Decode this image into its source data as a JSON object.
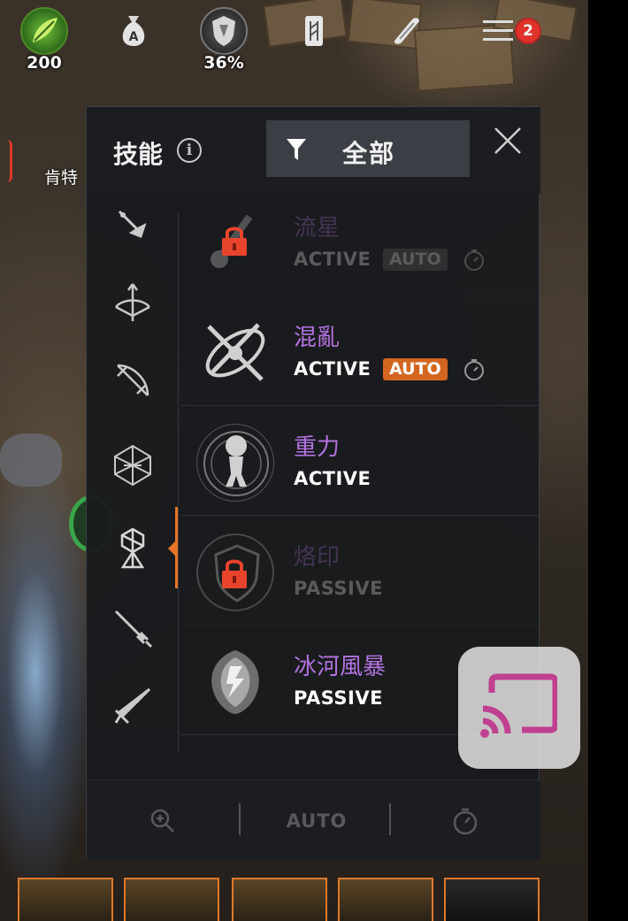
{
  "hud": {
    "items": [
      {
        "icon": "leaf-icon",
        "value": "200"
      },
      {
        "icon": "money-bag-icon",
        "value": ""
      },
      {
        "icon": "shield-icon",
        "value": "36%"
      },
      {
        "icon": "rune-tablet-icon",
        "value": ""
      },
      {
        "icon": "scroll-icon",
        "value": ""
      },
      {
        "icon": "menu-icon",
        "value": ""
      }
    ],
    "notification_count": "2",
    "npc_name": "肯特"
  },
  "panel": {
    "title": "技能",
    "filter_label": "全部",
    "categories": [
      {
        "icon": "meteor-arrow-icon",
        "active": false
      },
      {
        "icon": "bow-arrow-icon",
        "active": false
      },
      {
        "icon": "crossbow-icon",
        "active": false
      },
      {
        "icon": "polyhedron-icon",
        "active": false
      },
      {
        "icon": "rune-totem-icon",
        "active": true
      },
      {
        "icon": "sword-icon",
        "active": false
      },
      {
        "icon": "dagger-icon",
        "active": false
      }
    ],
    "skills": [
      {
        "name": "流星",
        "type": "ACTIVE",
        "auto": "AUTO",
        "locked": true
      },
      {
        "name": "混亂",
        "type": "ACTIVE",
        "auto": "AUTO",
        "locked": false
      },
      {
        "name": "重力",
        "type": "ACTIVE",
        "auto": "",
        "locked": false
      },
      {
        "name": "烙印",
        "type": "PASSIVE",
        "auto": "",
        "locked": true
      },
      {
        "name": "冰河風暴",
        "type": "PASSIVE",
        "auto": "",
        "locked": false
      }
    ],
    "footer": {
      "auto_label": "AUTO"
    }
  },
  "colors": {
    "skill_name": "#b473e0",
    "accent_orange": "#e77524",
    "lock_red": "#e8442c",
    "badge_red": "#e0312b",
    "cast_icon": "#c0408f"
  }
}
